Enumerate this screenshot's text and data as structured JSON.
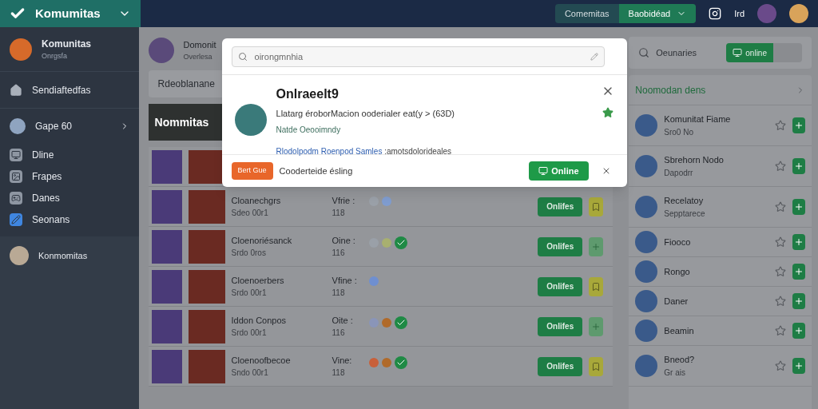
{
  "topbar": {
    "brand": "Komumitas",
    "segments": [
      {
        "label": "Comemitas",
        "selected": false
      },
      {
        "label": "Baobidéad",
        "selected": true
      }
    ],
    "user_label": "Ird"
  },
  "sidebar": {
    "profile": {
      "name": "Komunitas",
      "sub": "Onrgsfa"
    },
    "home": "Sendiaftedfas",
    "group": {
      "label": "Gape 60",
      "expanded": false
    },
    "items": [
      {
        "label": "Dline",
        "selected": false
      },
      {
        "label": "Frapes",
        "selected": false
      },
      {
        "label": "Danes",
        "selected": false
      },
      {
        "label": "Seonans",
        "selected": true
      }
    ],
    "footer_user": "Konmomitas"
  },
  "main": {
    "header": {
      "name": "Domonit",
      "sub": "Overlesa"
    },
    "filter": "Rdeoblanane",
    "banner": "Nommitas",
    "rows": [
      {
        "badges": []
      },
      {
        "name": "Cloanechgrs",
        "sub": "Sdeo 00r1",
        "label": "Vfrie :",
        "count": "118",
        "button": "Onlifes",
        "side_button": {
          "kind": "pin"
        },
        "badges": [
          {
            "kind": "dot",
            "color": "#9aa0a8"
          },
          {
            "kind": "dot",
            "color": "#7f9ccf"
          }
        ]
      },
      {
        "name": "Cloenoriésanck",
        "sub": "Srdo 0ros",
        "label": "Oine :",
        "count": "116",
        "button": "Onlifes",
        "side_button": {
          "kind": "add"
        },
        "badges": [
          {
            "kind": "dot",
            "color": "#9aa0a8"
          },
          {
            "kind": "dot",
            "color": "#a8b070"
          },
          {
            "kind": "check"
          }
        ]
      },
      {
        "name": "Cloenoerbers",
        "sub": "Srdo 00r1",
        "label": "Vfine :",
        "count": "118",
        "button": "Onlifes",
        "side_button": {
          "kind": "pin"
        },
        "badges": [
          {
            "kind": "dot",
            "color": "#6f8fd0"
          }
        ]
      },
      {
        "name": "Iddon Conpos",
        "sub": "Srdo 00r1",
        "label": "Oite :",
        "count": "116",
        "button": "Onlifes",
        "side_button": {
          "kind": "add"
        },
        "badges": [
          {
            "kind": "dot",
            "color": "#8a95b8"
          },
          {
            "kind": "dot",
            "color": "#b06a2a"
          },
          {
            "kind": "check"
          }
        ]
      },
      {
        "name": "Cloenoofbecoe",
        "sub": "Sndo 00r1",
        "label": "Vine:",
        "count": "118",
        "button": "Onlifes",
        "side_button": {
          "kind": "pin"
        },
        "badges": [
          {
            "kind": "dot",
            "color": "#c8603a"
          },
          {
            "kind": "dot",
            "color": "#b06a2a"
          },
          {
            "kind": "check"
          }
        ]
      }
    ]
  },
  "dialog": {
    "search": {
      "placeholder": "oirongmnhia"
    },
    "title": "Onlraeelt9",
    "line": "Llatarg éroborMacion ooderialer eat(y > (63D)",
    "sub": "Natde Oeooimndy",
    "link": "Rlodolpodm Roenpod Samles",
    "link_rest": ":amotsdolorideales",
    "favorite": true,
    "tag": "Bert Gue",
    "footer_text": "Cooderteide ésling",
    "button": "Online"
  },
  "right": {
    "search": {
      "placeholder": "Oeunaries"
    },
    "toggle": {
      "label": "online",
      "on": true
    },
    "list_title": "Noomodan dens",
    "items": [
      {
        "name": "Komunitat Fiame",
        "sub": "Sro0 No"
      },
      {
        "name": "Sbrehorn Nodo",
        "sub": "Dapodrr"
      },
      {
        "name": "Recelatoy",
        "sub": "Sepptarece"
      },
      {
        "name": "Fiooco"
      },
      {
        "name": "Rongo"
      },
      {
        "name": "Daner"
      },
      {
        "name": "Beamin"
      },
      {
        "name": "Bneod?",
        "sub": "Gr ais"
      }
    ]
  }
}
